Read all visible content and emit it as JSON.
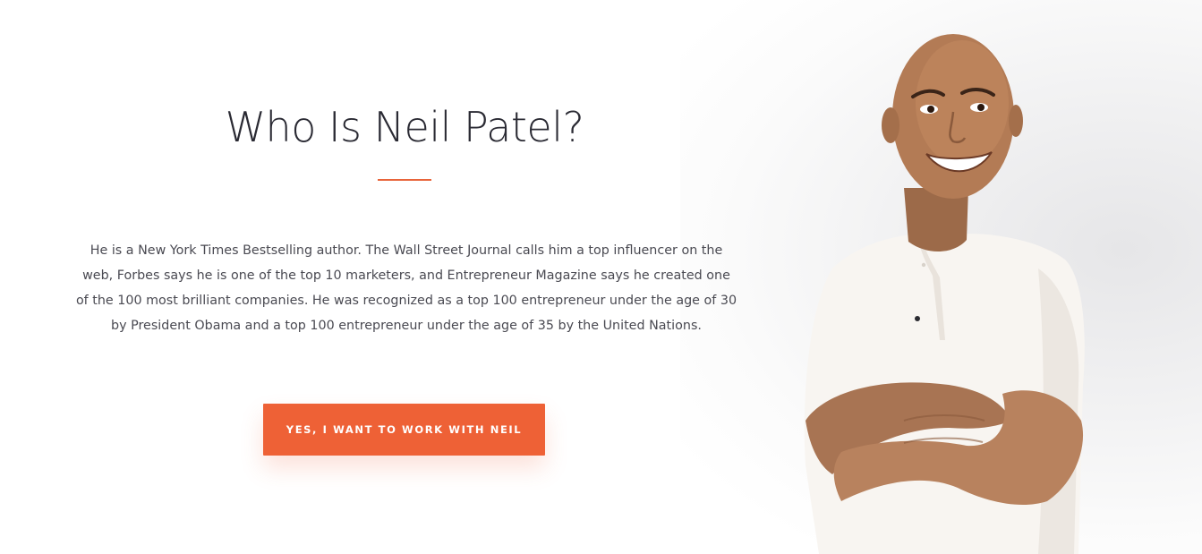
{
  "section": {
    "title": "Who Is Neil Patel?",
    "bio": "He is a New York Times Bestselling author. The Wall Street Journal calls him a top influencer on the web, Forbes says he is one of the top 10 marketers, and Entrepreneur Magazine says he created one of the 100 most brilliant companies. He was recognized as a top 100 entrepreneur under the age of 30 by President Obama and a top 100 entrepreneur under the age of 35 by the United Nations.",
    "cta_label": "YES, I WANT TO WORK WITH NEIL"
  },
  "colors": {
    "accent": "#ee6136",
    "title_text": "#2a2a33",
    "body_text": "#4a4a52",
    "background": "#ffffff"
  }
}
